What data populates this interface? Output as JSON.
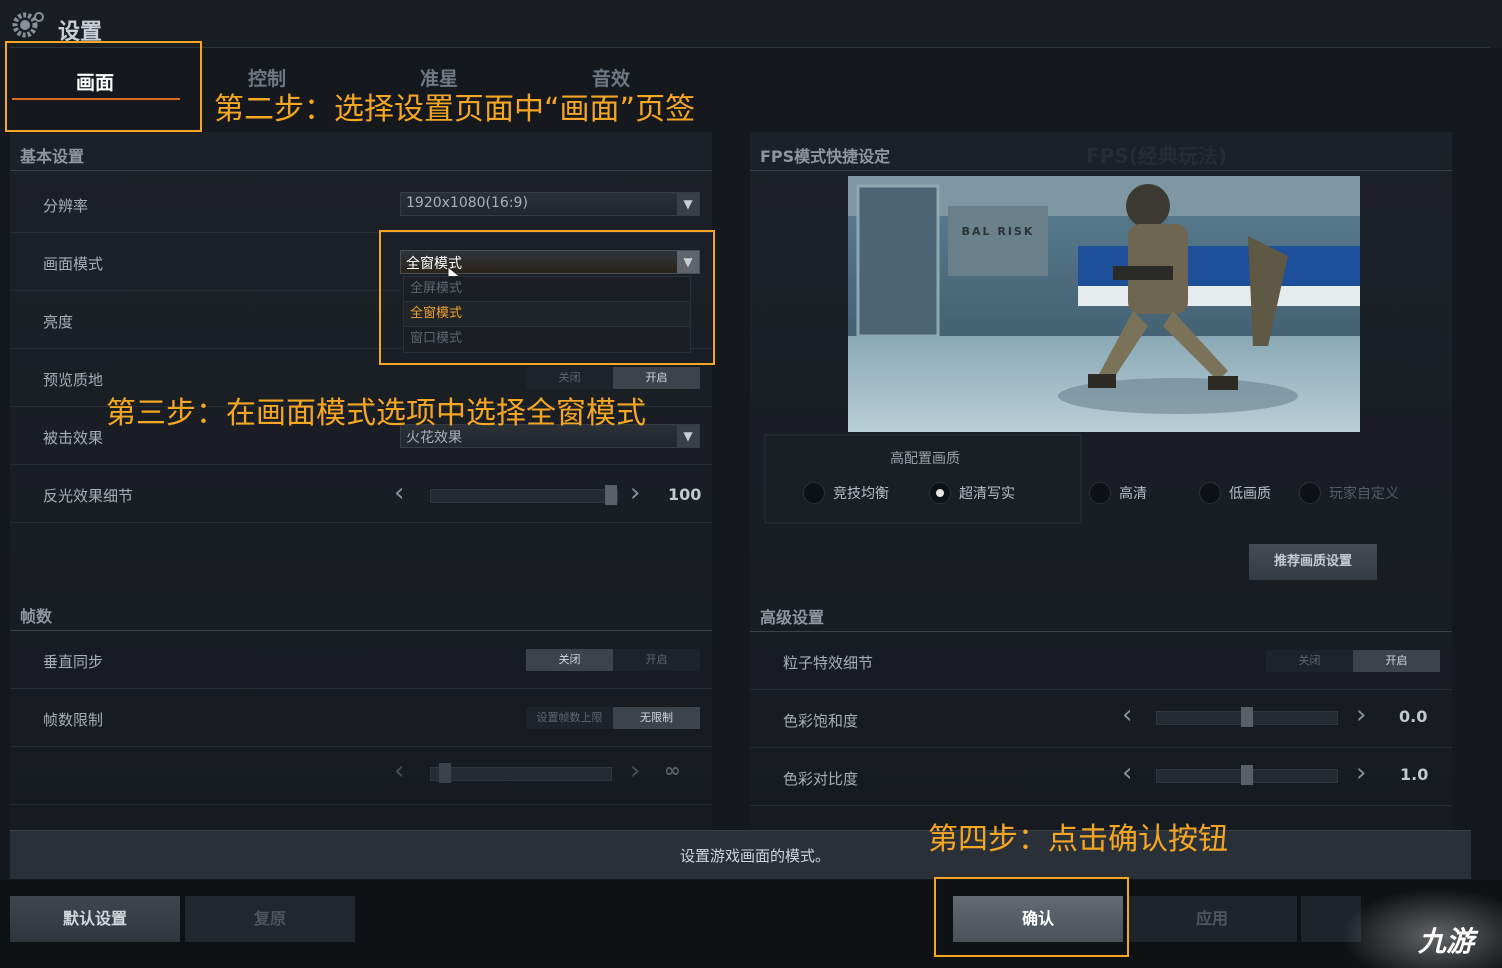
{
  "header": {
    "title": "设置"
  },
  "tabs": [
    {
      "label": "画面",
      "active": true
    },
    {
      "label": "控制",
      "active": false
    },
    {
      "label": "准星",
      "active": false
    },
    {
      "label": "音效",
      "active": false
    }
  ],
  "basic": {
    "title": "基本设置",
    "resolution": {
      "label": "分辨率",
      "value": "1920x1080(16:9)"
    },
    "screen_mode": {
      "label": "画面模式",
      "value": "全窗模式",
      "options": [
        "全屏模式",
        "全窗模式",
        "窗口模式"
      ]
    },
    "brightness": {
      "label": "亮度"
    },
    "preview_quality": {
      "label": "预览质地",
      "off": "关闭",
      "on": "开启"
    },
    "hit_effect": {
      "label": "被击效果",
      "value": "火花效果"
    },
    "reflection": {
      "label": "反光效果细节",
      "value": "100",
      "level": 1.0
    }
  },
  "fps_section": {
    "title": "帧数",
    "vsync": {
      "label": "垂直同步",
      "off": "关闭",
      "on": "开启"
    },
    "fps_limit": {
      "label": "帧数限制",
      "set": "设置帧数上限",
      "unlimited": "无限制",
      "value": "∞",
      "level": 0.05
    }
  },
  "quick": {
    "title": "FPS模式快捷设定",
    "overlay_text": "FPS(经典玩法)",
    "preview_sign": "BAL RISK",
    "group_label": "高配置画质",
    "options": [
      {
        "label": "竞技均衡",
        "selected": false
      },
      {
        "label": "超清写实",
        "selected": true
      },
      {
        "label": "高清",
        "selected": false
      },
      {
        "label": "低画质",
        "selected": false
      },
      {
        "label": "玩家自定义",
        "selected": false
      }
    ],
    "recommend_button": "推荐画质设置"
  },
  "advanced": {
    "title": "高级设置",
    "particle": {
      "label": "粒子特效细节",
      "off": "关闭",
      "on": "开启"
    },
    "saturation": {
      "label": "色彩饱和度",
      "value": "0.0",
      "level": 0.5
    },
    "contrast": {
      "label": "色彩对比度",
      "value": "1.0",
      "level": 0.5
    }
  },
  "status": {
    "text": "设置游戏画面的模式。"
  },
  "footer": {
    "default": "默认设置",
    "restore": "复原",
    "confirm": "确认",
    "apply": "应用"
  },
  "annotations": {
    "step2": "第二步：选择设置页面中“画面”页签",
    "step3": "第三步：在画面模式选项中选择全窗模式",
    "step4": "第四步：点击确认按钮"
  },
  "watermark": "九游",
  "colors": {
    "accent": "#f5a623",
    "tab_underline": "#e06a1c",
    "selected_option": "#f0a030"
  }
}
